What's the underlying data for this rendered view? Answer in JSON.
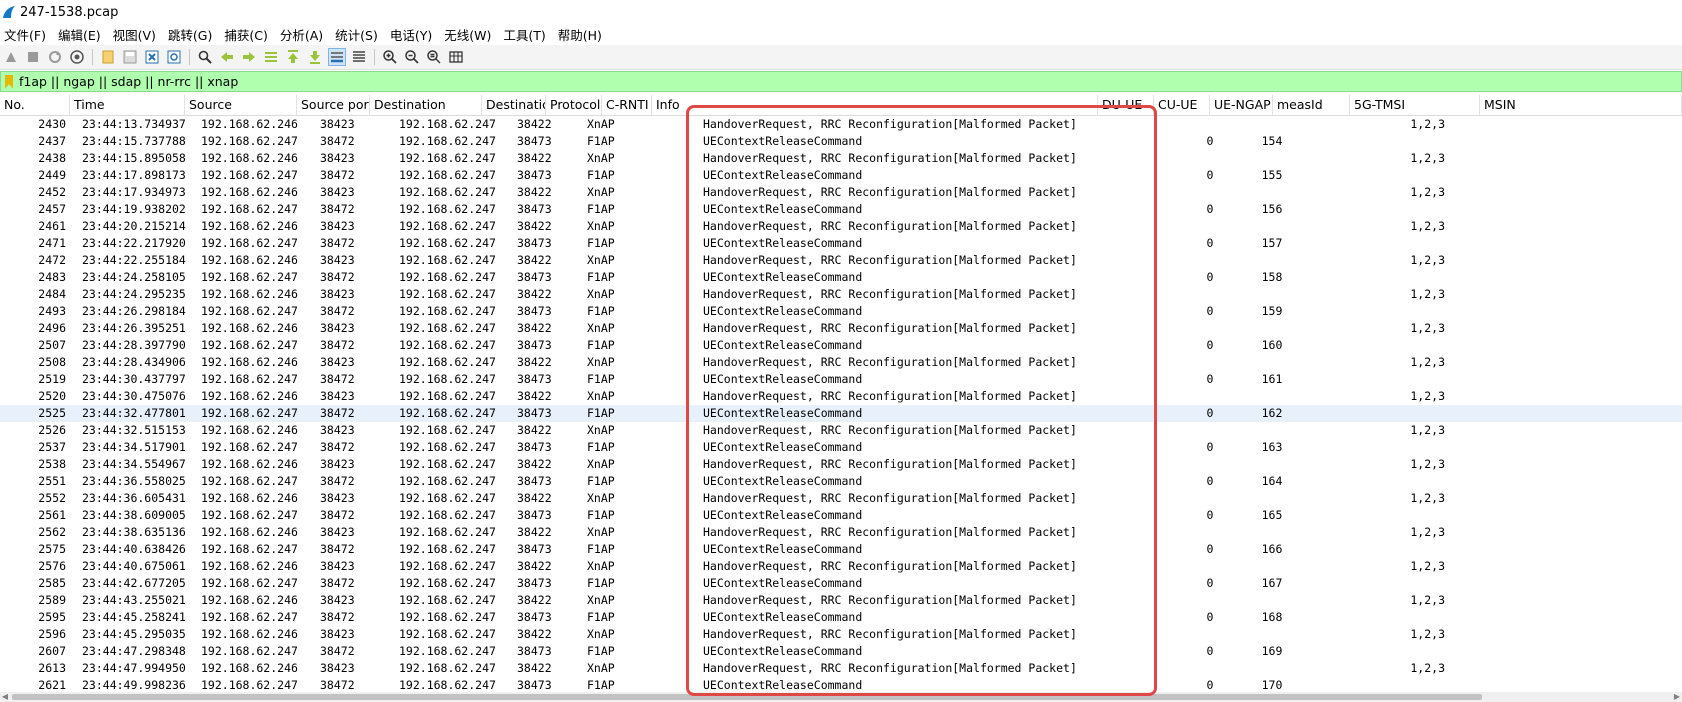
{
  "window": {
    "title": "247-1538.pcap"
  },
  "menu": [
    "文件(F)",
    "编辑(E)",
    "视图(V)",
    "跳转(G)",
    "捕获(C)",
    "分析(A)",
    "统计(S)",
    "电话(Y)",
    "无线(W)",
    "工具(T)",
    "帮助(H)"
  ],
  "toolbar": [
    {
      "name": "start-capture-icon"
    },
    {
      "name": "stop-capture-icon"
    },
    {
      "name": "restart-capture-icon"
    },
    {
      "name": "capture-options-icon"
    },
    {
      "sep": true
    },
    {
      "name": "open-file-icon"
    },
    {
      "name": "save-file-icon"
    },
    {
      "name": "close-file-icon"
    },
    {
      "name": "reload-file-icon"
    },
    {
      "sep": true
    },
    {
      "name": "find-packet-icon"
    },
    {
      "name": "go-back-icon"
    },
    {
      "name": "go-forward-icon"
    },
    {
      "name": "go-to-packet-icon"
    },
    {
      "name": "go-first-icon"
    },
    {
      "name": "go-last-icon"
    },
    {
      "name": "auto-scroll-icon",
      "active": true
    },
    {
      "name": "colorize-icon"
    },
    {
      "sep": true
    },
    {
      "name": "zoom-in-icon"
    },
    {
      "name": "zoom-out-icon"
    },
    {
      "name": "zoom-normal-icon"
    },
    {
      "name": "resize-columns-icon"
    }
  ],
  "filter": {
    "value": "f1ap || ngap || sdap || nr-rrc || xnap"
  },
  "columns": [
    "No.",
    "Time",
    "Source",
    "Source port",
    "Destination",
    "Destination port",
    "Protocol",
    "C-RNTI",
    "Info",
    "DU-UE",
    "CU-UE",
    "UE-NGAP",
    "measId",
    "5G-TMSI",
    "MSIN"
  ],
  "packets": [
    {
      "no": "2430",
      "time": "23:44:13.734937",
      "src": "192.168.62.246",
      "sport": "38423",
      "dst": "192.168.62.247",
      "dport": "38422",
      "proto": "XnAP",
      "info": "HandoverRequest, RRC Reconfiguration[Malformed Packet]",
      "du": "",
      "cu": "",
      "meas": "1,2,3"
    },
    {
      "no": "2437",
      "time": "23:44:15.737788",
      "src": "192.168.62.247",
      "sport": "38472",
      "dst": "192.168.62.247",
      "dport": "38473",
      "proto": "F1AP",
      "info": "UEContextReleaseCommand",
      "du": "0",
      "cu": "154",
      "meas": ""
    },
    {
      "no": "2438",
      "time": "23:44:15.895058",
      "src": "192.168.62.246",
      "sport": "38423",
      "dst": "192.168.62.247",
      "dport": "38422",
      "proto": "XnAP",
      "info": "HandoverRequest, RRC Reconfiguration[Malformed Packet]",
      "du": "",
      "cu": "",
      "meas": "1,2,3"
    },
    {
      "no": "2449",
      "time": "23:44:17.898173",
      "src": "192.168.62.247",
      "sport": "38472",
      "dst": "192.168.62.247",
      "dport": "38473",
      "proto": "F1AP",
      "info": "UEContextReleaseCommand",
      "du": "0",
      "cu": "155",
      "meas": ""
    },
    {
      "no": "2452",
      "time": "23:44:17.934973",
      "src": "192.168.62.246",
      "sport": "38423",
      "dst": "192.168.62.247",
      "dport": "38422",
      "proto": "XnAP",
      "info": "HandoverRequest, RRC Reconfiguration[Malformed Packet]",
      "du": "",
      "cu": "",
      "meas": "1,2,3"
    },
    {
      "no": "2457",
      "time": "23:44:19.938202",
      "src": "192.168.62.247",
      "sport": "38472",
      "dst": "192.168.62.247",
      "dport": "38473",
      "proto": "F1AP",
      "info": "UEContextReleaseCommand",
      "du": "0",
      "cu": "156",
      "meas": ""
    },
    {
      "no": "2461",
      "time": "23:44:20.215214",
      "src": "192.168.62.246",
      "sport": "38423",
      "dst": "192.168.62.247",
      "dport": "38422",
      "proto": "XnAP",
      "info": "HandoverRequest, RRC Reconfiguration[Malformed Packet]",
      "du": "",
      "cu": "",
      "meas": "1,2,3"
    },
    {
      "no": "2471",
      "time": "23:44:22.217920",
      "src": "192.168.62.247",
      "sport": "38472",
      "dst": "192.168.62.247",
      "dport": "38473",
      "proto": "F1AP",
      "info": "UEContextReleaseCommand",
      "du": "0",
      "cu": "157",
      "meas": ""
    },
    {
      "no": "2472",
      "time": "23:44:22.255184",
      "src": "192.168.62.246",
      "sport": "38423",
      "dst": "192.168.62.247",
      "dport": "38422",
      "proto": "XnAP",
      "info": "HandoverRequest, RRC Reconfiguration[Malformed Packet]",
      "du": "",
      "cu": "",
      "meas": "1,2,3"
    },
    {
      "no": "2483",
      "time": "23:44:24.258105",
      "src": "192.168.62.247",
      "sport": "38472",
      "dst": "192.168.62.247",
      "dport": "38473",
      "proto": "F1AP",
      "info": "UEContextReleaseCommand",
      "du": "0",
      "cu": "158",
      "meas": ""
    },
    {
      "no": "2484",
      "time": "23:44:24.295235",
      "src": "192.168.62.246",
      "sport": "38423",
      "dst": "192.168.62.247",
      "dport": "38422",
      "proto": "XnAP",
      "info": "HandoverRequest, RRC Reconfiguration[Malformed Packet]",
      "du": "",
      "cu": "",
      "meas": "1,2,3"
    },
    {
      "no": "2493",
      "time": "23:44:26.298184",
      "src": "192.168.62.247",
      "sport": "38472",
      "dst": "192.168.62.247",
      "dport": "38473",
      "proto": "F1AP",
      "info": "UEContextReleaseCommand",
      "du": "0",
      "cu": "159",
      "meas": ""
    },
    {
      "no": "2496",
      "time": "23:44:26.395251",
      "src": "192.168.62.246",
      "sport": "38423",
      "dst": "192.168.62.247",
      "dport": "38422",
      "proto": "XnAP",
      "info": "HandoverRequest, RRC Reconfiguration[Malformed Packet]",
      "du": "",
      "cu": "",
      "meas": "1,2,3"
    },
    {
      "no": "2507",
      "time": "23:44:28.397790",
      "src": "192.168.62.247",
      "sport": "38472",
      "dst": "192.168.62.247",
      "dport": "38473",
      "proto": "F1AP",
      "info": "UEContextReleaseCommand",
      "du": "0",
      "cu": "160",
      "meas": ""
    },
    {
      "no": "2508",
      "time": "23:44:28.434906",
      "src": "192.168.62.246",
      "sport": "38423",
      "dst": "192.168.62.247",
      "dport": "38422",
      "proto": "XnAP",
      "info": "HandoverRequest, RRC Reconfiguration[Malformed Packet]",
      "du": "",
      "cu": "",
      "meas": "1,2,3"
    },
    {
      "no": "2519",
      "time": "23:44:30.437797",
      "src": "192.168.62.247",
      "sport": "38472",
      "dst": "192.168.62.247",
      "dport": "38473",
      "proto": "F1AP",
      "info": "UEContextReleaseCommand",
      "du": "0",
      "cu": "161",
      "meas": ""
    },
    {
      "no": "2520",
      "time": "23:44:30.475076",
      "src": "192.168.62.246",
      "sport": "38423",
      "dst": "192.168.62.247",
      "dport": "38422",
      "proto": "XnAP",
      "info": "HandoverRequest, RRC Reconfiguration[Malformed Packet]",
      "du": "",
      "cu": "",
      "meas": "1,2,3"
    },
    {
      "no": "2525",
      "time": "23:44:32.477801",
      "src": "192.168.62.247",
      "sport": "38472",
      "dst": "192.168.62.247",
      "dport": "38473",
      "proto": "F1AP",
      "info": "UEContextReleaseCommand",
      "du": "0",
      "cu": "162",
      "meas": "",
      "selected": true
    },
    {
      "no": "2526",
      "time": "23:44:32.515153",
      "src": "192.168.62.246",
      "sport": "38423",
      "dst": "192.168.62.247",
      "dport": "38422",
      "proto": "XnAP",
      "info": "HandoverRequest, RRC Reconfiguration[Malformed Packet]",
      "du": "",
      "cu": "",
      "meas": "1,2,3"
    },
    {
      "no": "2537",
      "time": "23:44:34.517901",
      "src": "192.168.62.247",
      "sport": "38472",
      "dst": "192.168.62.247",
      "dport": "38473",
      "proto": "F1AP",
      "info": "UEContextReleaseCommand",
      "du": "0",
      "cu": "163",
      "meas": ""
    },
    {
      "no": "2538",
      "time": "23:44:34.554967",
      "src": "192.168.62.246",
      "sport": "38423",
      "dst": "192.168.62.247",
      "dport": "38422",
      "proto": "XnAP",
      "info": "HandoverRequest, RRC Reconfiguration[Malformed Packet]",
      "du": "",
      "cu": "",
      "meas": "1,2,3"
    },
    {
      "no": "2551",
      "time": "23:44:36.558025",
      "src": "192.168.62.247",
      "sport": "38472",
      "dst": "192.168.62.247",
      "dport": "38473",
      "proto": "F1AP",
      "info": "UEContextReleaseCommand",
      "du": "0",
      "cu": "164",
      "meas": ""
    },
    {
      "no": "2552",
      "time": "23:44:36.605431",
      "src": "192.168.62.246",
      "sport": "38423",
      "dst": "192.168.62.247",
      "dport": "38422",
      "proto": "XnAP",
      "info": "HandoverRequest, RRC Reconfiguration[Malformed Packet]",
      "du": "",
      "cu": "",
      "meas": "1,2,3"
    },
    {
      "no": "2561",
      "time": "23:44:38.609005",
      "src": "192.168.62.247",
      "sport": "38472",
      "dst": "192.168.62.247",
      "dport": "38473",
      "proto": "F1AP",
      "info": "UEContextReleaseCommand",
      "du": "0",
      "cu": "165",
      "meas": ""
    },
    {
      "no": "2562",
      "time": "23:44:38.635136",
      "src": "192.168.62.246",
      "sport": "38423",
      "dst": "192.168.62.247",
      "dport": "38422",
      "proto": "XnAP",
      "info": "HandoverRequest, RRC Reconfiguration[Malformed Packet]",
      "du": "",
      "cu": "",
      "meas": "1,2,3"
    },
    {
      "no": "2575",
      "time": "23:44:40.638426",
      "src": "192.168.62.247",
      "sport": "38472",
      "dst": "192.168.62.247",
      "dport": "38473",
      "proto": "F1AP",
      "info": "UEContextReleaseCommand",
      "du": "0",
      "cu": "166",
      "meas": ""
    },
    {
      "no": "2576",
      "time": "23:44:40.675061",
      "src": "192.168.62.246",
      "sport": "38423",
      "dst": "192.168.62.247",
      "dport": "38422",
      "proto": "XnAP",
      "info": "HandoverRequest, RRC Reconfiguration[Malformed Packet]",
      "du": "",
      "cu": "",
      "meas": "1,2,3"
    },
    {
      "no": "2585",
      "time": "23:44:42.677205",
      "src": "192.168.62.247",
      "sport": "38472",
      "dst": "192.168.62.247",
      "dport": "38473",
      "proto": "F1AP",
      "info": "UEContextReleaseCommand",
      "du": "0",
      "cu": "167",
      "meas": ""
    },
    {
      "no": "2589",
      "time": "23:44:43.255021",
      "src": "192.168.62.246",
      "sport": "38423",
      "dst": "192.168.62.247",
      "dport": "38422",
      "proto": "XnAP",
      "info": "HandoverRequest, RRC Reconfiguration[Malformed Packet]",
      "du": "",
      "cu": "",
      "meas": "1,2,3"
    },
    {
      "no": "2595",
      "time": "23:44:45.258241",
      "src": "192.168.62.247",
      "sport": "38472",
      "dst": "192.168.62.247",
      "dport": "38473",
      "proto": "F1AP",
      "info": "UEContextReleaseCommand",
      "du": "0",
      "cu": "168",
      "meas": ""
    },
    {
      "no": "2596",
      "time": "23:44:45.295035",
      "src": "192.168.62.246",
      "sport": "38423",
      "dst": "192.168.62.247",
      "dport": "38422",
      "proto": "XnAP",
      "info": "HandoverRequest, RRC Reconfiguration[Malformed Packet]",
      "du": "",
      "cu": "",
      "meas": "1,2,3"
    },
    {
      "no": "2607",
      "time": "23:44:47.298348",
      "src": "192.168.62.247",
      "sport": "38472",
      "dst": "192.168.62.247",
      "dport": "38473",
      "proto": "F1AP",
      "info": "UEContextReleaseCommand",
      "du": "0",
      "cu": "169",
      "meas": ""
    },
    {
      "no": "2613",
      "time": "23:44:47.994950",
      "src": "192.168.62.246",
      "sport": "38423",
      "dst": "192.168.62.247",
      "dport": "38422",
      "proto": "XnAP",
      "info": "HandoverRequest, RRC Reconfiguration[Malformed Packet]",
      "du": "",
      "cu": "",
      "meas": "1,2,3"
    },
    {
      "no": "2621",
      "time": "23:44:49.998236",
      "src": "192.168.62.247",
      "sport": "38472",
      "dst": "192.168.62.247",
      "dport": "38473",
      "proto": "F1AP",
      "info": "UEContextReleaseCommand",
      "du": "0",
      "cu": "170",
      "meas": ""
    }
  ],
  "colors": {
    "filter_bg": "#afffaf",
    "selected_row": "#e8f1fb",
    "highlight_box": "#e04848"
  }
}
